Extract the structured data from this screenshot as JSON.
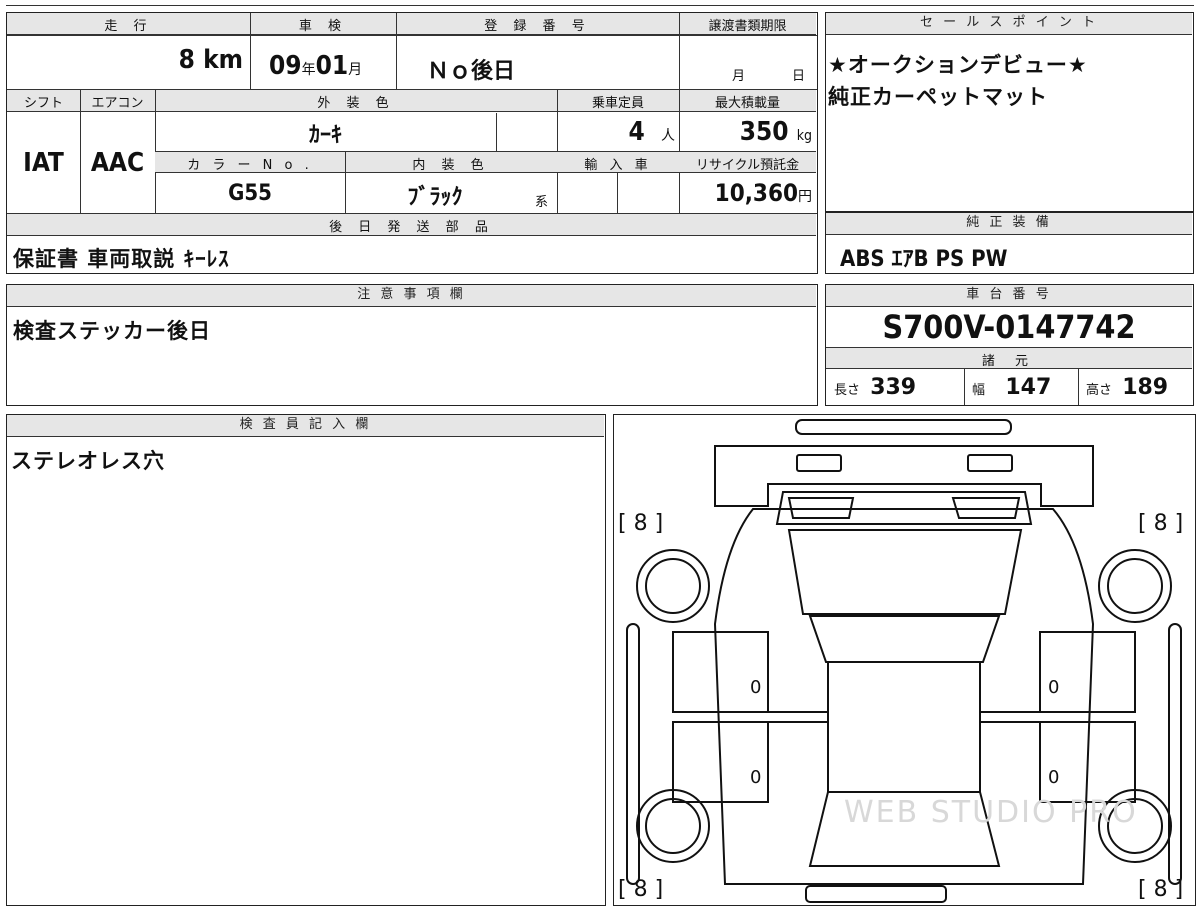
{
  "vehicle": {
    "headers": {
      "mileage": "走 行",
      "inspection": "車 検",
      "registration": "登 録 番 号",
      "transfer_deadline": "譲渡書類期限",
      "shift": "シフト",
      "aircon": "エアコン",
      "exterior_color": "外 装 色",
      "capacity": "乗車定員",
      "max_load": "最大積載量",
      "color_no": "カ ラ ー N o .",
      "interior_color": "内 装 色",
      "import": "輸 入 車",
      "recycle": "リサイクル預託金",
      "parts": "後 日 発 送 部 品"
    },
    "mileage": "8",
    "mileage_unit": "km",
    "inspection_year": "09",
    "year_unit": "年",
    "inspection_month": "01",
    "month_unit": "月",
    "registration": "Ｎｏ後日",
    "transfer_month": "月",
    "transfer_day": "日",
    "shift": "IAT",
    "aircon": "AAC",
    "exterior_color": "ｶｰｷ",
    "capacity": "4",
    "capacity_unit": "人",
    "max_load": "350",
    "max_load_unit": "kg",
    "color_no": "G55",
    "interior_color": "ﾌﾞﾗｯｸ",
    "interior_suffix": "系",
    "recycle": "10,360",
    "recycle_unit": "円",
    "parts": "保証書 車両取説 ｷｰﾚｽ"
  },
  "sales": {
    "header": "セ ー ル ス ポ イ ン ト",
    "line1": "★オークションデビュー★",
    "line2": "純正カーペットマット"
  },
  "equipment": {
    "header": "純 正 装 備",
    "value": "ABS ｴｱB PS PW"
  },
  "notes": {
    "header": "注 意 事 項 欄",
    "value": "検査ステッカー後日"
  },
  "chassis": {
    "header": "車 台 番 号",
    "value": "S700V-0147742"
  },
  "specs": {
    "header": "諸 元",
    "length_label": "長さ",
    "length": "339",
    "width_label": "幅",
    "width": "147",
    "height_label": "高さ",
    "height": "189"
  },
  "inspector": {
    "header": "検 査 員 記 入 欄",
    "value": "ステレオレス穴"
  },
  "diagram": {
    "tire_fl": "[ 8 ]",
    "tire_fr": "[ 8 ]",
    "tire_rl": "[ 8 ]",
    "tire_rr": "[ 8 ]",
    "door_fl": "0",
    "door_fr": "0",
    "door_rl": "0",
    "door_rr": "0",
    "watermark": "WEB STUDIO PRO"
  }
}
